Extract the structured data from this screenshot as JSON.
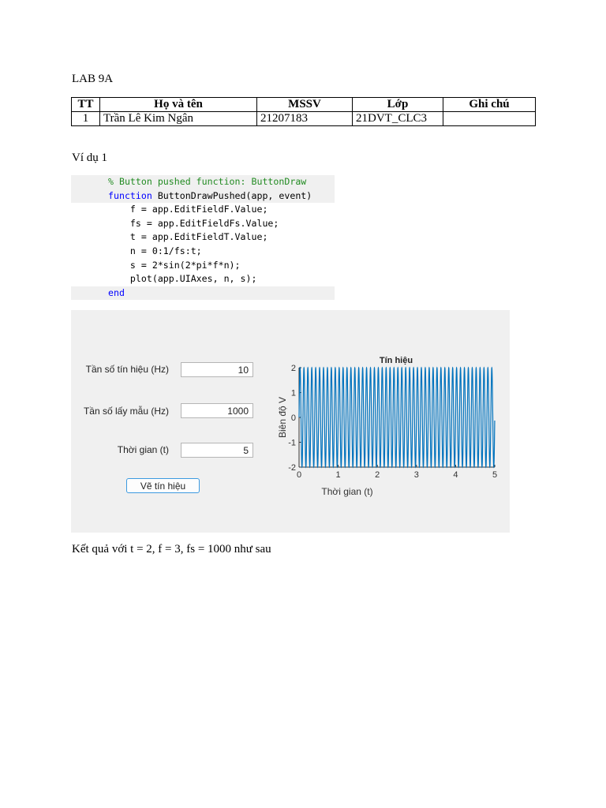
{
  "title": "LAB 9A",
  "table": {
    "headers": [
      "TT",
      "Họ và tên",
      "MSSV",
      "Lớp",
      "Ghi chú"
    ],
    "rows": [
      [
        "1",
        "Trần Lê Kim Ngân",
        "21207183",
        "21DVT_CLC3",
        ""
      ]
    ]
  },
  "section": "Ví dụ 1",
  "code": {
    "comment": "% Button pushed function: ButtonDraw",
    "kw_function": "function",
    "sig": " ButtonDrawPushed(app, event)",
    "lines": [
      "    f = app.EditFieldF.Value;",
      "    fs = app.EditFieldFs.Value;",
      "    t = app.EditFieldT.Value;",
      "    n = 0:1/fs:t;",
      "    s = 2*sin(2*pi*f*n);",
      "    plot(app.UIAxes, n, s);"
    ],
    "kw_end": "end"
  },
  "app": {
    "fields": [
      {
        "label": "Tần số tín hiệu (Hz)",
        "value": "10"
      },
      {
        "label": "Tần số lấy mẫu (Hz)",
        "value": "1000"
      },
      {
        "label": "Thời gian (t)",
        "value": "5"
      }
    ],
    "button": "Vẽ tín hiệu"
  },
  "chart_data": {
    "type": "line",
    "title": "Tín hiệu",
    "xlabel": "Thời gian (t)",
    "ylabel": "Biên độ V",
    "xlim": [
      0,
      5
    ],
    "ylim": [
      -2,
      2
    ],
    "xticks": [
      "0",
      "1",
      "2",
      "3",
      "4",
      "5"
    ],
    "yticks": [
      "2",
      "1",
      "0",
      "-1",
      "-2"
    ],
    "series": [
      {
        "name": "s",
        "function": "2*sin(2*pi*10*n)",
        "amplitude": 2,
        "frequency": 10,
        "fs": 1000,
        "color": "#0072bd"
      }
    ]
  },
  "result": "Kết quả với t = 2, f = 3, fs = 1000 như sau"
}
